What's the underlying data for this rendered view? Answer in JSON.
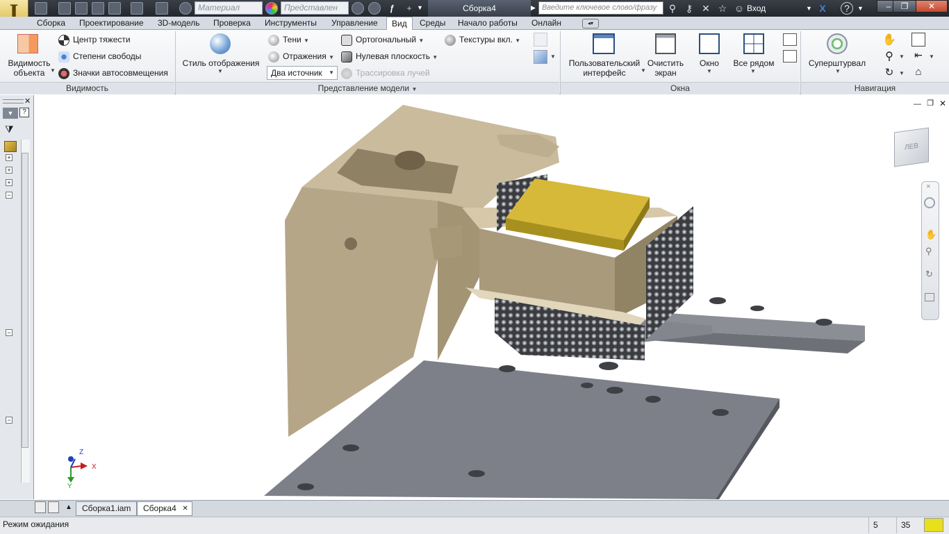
{
  "title_bar": {
    "app_icon": "autodesk-inventor-icon",
    "app_letter": "I",
    "material_placeholder": "Материал",
    "representation_placeholder": "Представлен",
    "document_title": "Сборка4",
    "search_placeholder": "Введите ключевое слово/фразу",
    "login_label": "Вход"
  },
  "tabs": [
    "Сборка",
    "Проектирование",
    "3D-модель",
    "Проверка",
    "Инструменты",
    "Управление",
    "Вид",
    "Среды",
    "Начало работы",
    "Онлайн"
  ],
  "active_tab": "Вид",
  "ribbon": {
    "visibility": {
      "object_visibility_line1": "Видимость",
      "object_visibility_line2": "объекта",
      "center_of_gravity": "Центр тяжести",
      "degrees_of_freedom": "Степени свободы",
      "autolimit_icons": "Значки автосовмещения",
      "panel_title": "Видимость"
    },
    "model_view": {
      "display_style": "Стиль отображения",
      "shadows": "Тени",
      "reflections": "Отражения",
      "light_source_value": "Два источник",
      "orthographic": "Ортогональный",
      "ground_plane": "Нулевая плоскость",
      "ray_tracing": "Трассировка лучей",
      "textures": "Текстуры вкл.",
      "panel_title": "Представление модели"
    },
    "windows": {
      "user_interface_line1": "Пользовательский",
      "user_interface_line2": "интерфейс",
      "clean_screen_line1": "Очистить",
      "clean_screen_line2": "экран",
      "window": "Окно",
      "tile_all": "Все рядом",
      "panel_title": "Окна"
    },
    "navigation": {
      "steering_wheel": "Суперштурвал",
      "panel_title": "Навигация"
    }
  },
  "viewcube": {
    "face_label": "ЛЕВ"
  },
  "triad": {
    "x": "X",
    "y": "Y",
    "z": "Z"
  },
  "document_tabs": [
    "Сборка1.iam",
    "Сборка4"
  ],
  "active_document": "Сборка4",
  "status": {
    "text": "Режим ожидания",
    "count1": "5",
    "count2": "35"
  },
  "colors": {
    "accent_yellow": "#d9b441",
    "model_beige": "#c2b393",
    "plate_gray": "#8e9199",
    "block_gold": "#c9a92a"
  }
}
